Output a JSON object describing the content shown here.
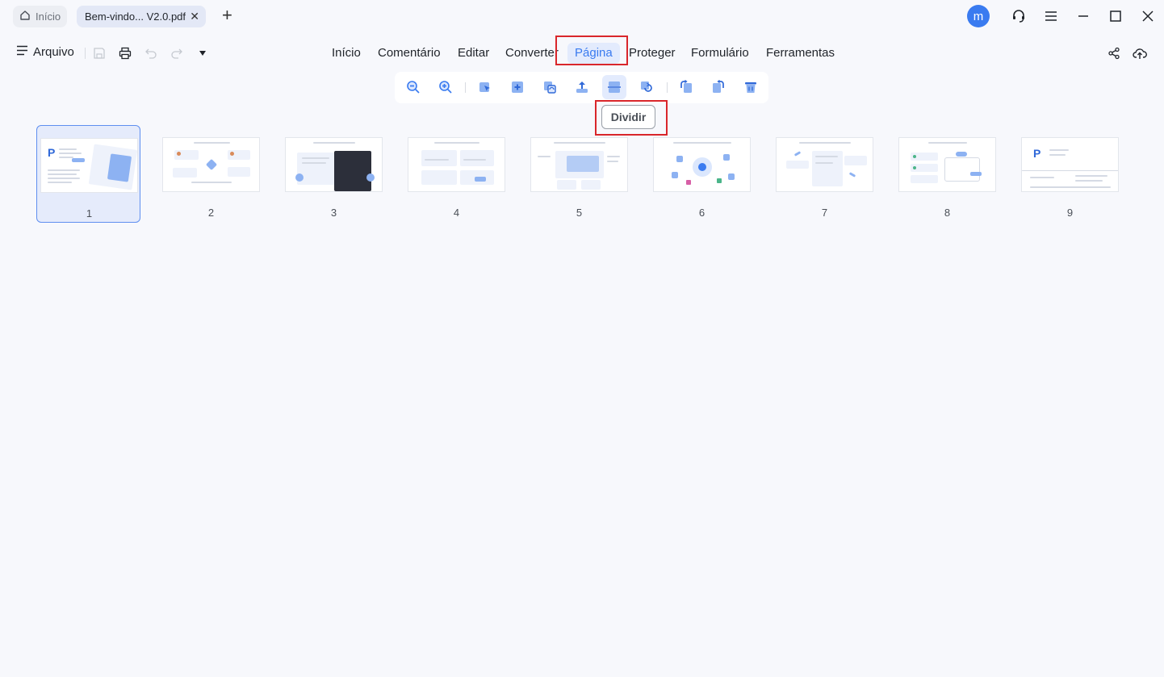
{
  "titlebar": {
    "home_tab_label": "Início",
    "doc_tab_label": "Bem-vindo... V2.0.pdf",
    "close_glyph": "✕",
    "new_tab_glyph": "+",
    "avatar_letter": "m",
    "icons": [
      "home-icon",
      "support-headset-icon",
      "hamburger-menu-icon",
      "minimize-icon",
      "maximize-icon",
      "close-window-icon"
    ]
  },
  "menubar": {
    "file_label": "Arquivo",
    "items": [
      {
        "label": "Início"
      },
      {
        "label": "Comentário"
      },
      {
        "label": "Editar"
      },
      {
        "label": "Converter"
      },
      {
        "label": "Página",
        "active": true
      },
      {
        "label": "Proteger"
      },
      {
        "label": "Formulário"
      },
      {
        "label": "Ferramentas"
      }
    ],
    "quick_icons": [
      "save-icon",
      "print-icon",
      "undo-icon",
      "redo-icon",
      "dropdown-arrow-icon"
    ],
    "right_icons": [
      "share-icon",
      "cloud-upload-icon"
    ]
  },
  "toolbar": {
    "tools": [
      "zoom-out-icon",
      "zoom-in-icon",
      "select-pointer-icon",
      "insert-page-icon",
      "replace-page-icon",
      "extract-page-icon",
      "split-page-icon",
      "rotate-swap-icon",
      "rotate-left-icon",
      "rotate-right-icon",
      "delete-page-icon"
    ],
    "active_tool": "split-page-icon",
    "tooltip": "Dividir"
  },
  "pages": [
    {
      "number": "1",
      "selected": true
    },
    {
      "number": "2"
    },
    {
      "number": "3"
    },
    {
      "number": "4"
    },
    {
      "number": "5"
    },
    {
      "number": "6"
    },
    {
      "number": "7"
    },
    {
      "number": "8"
    },
    {
      "number": "9"
    }
  ],
  "colors": {
    "accent": "#3a7bf0",
    "highlight_box": "#d9262b",
    "background": "#f7f8fc"
  }
}
